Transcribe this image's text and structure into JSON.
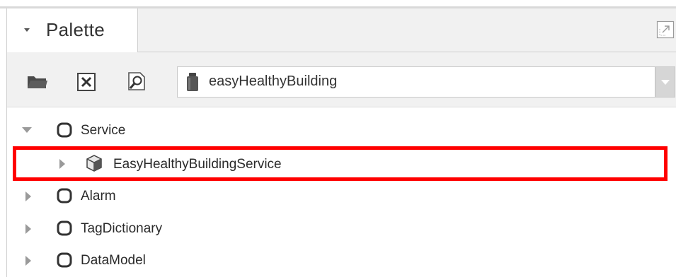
{
  "palette": {
    "tab_title": "Palette"
  },
  "toolbar": {
    "open_icon": "folder-open-icon",
    "close_icon": "close-palette-icon",
    "find_icon": "find-module-icon",
    "module_selector": {
      "value": "easyHealthyBuilding",
      "icon": "jar-icon"
    }
  },
  "tree": {
    "items": [
      {
        "label": "Service",
        "expanded": true,
        "icon": "folder-icon",
        "level": 0
      },
      {
        "label": "EasyHealthyBuildingService",
        "expanded": false,
        "icon": "component-icon",
        "level": 1,
        "highlighted": true
      },
      {
        "label": "Alarm",
        "expanded": false,
        "icon": "folder-icon",
        "level": 0
      },
      {
        "label": "TagDictionary",
        "expanded": false,
        "icon": "folder-icon",
        "level": 0
      },
      {
        "label": "DataModel",
        "expanded": false,
        "icon": "folder-icon",
        "level": 0
      }
    ]
  },
  "colors": {
    "highlight": "#ff0000",
    "panel_bg": "#f1f1f1"
  }
}
